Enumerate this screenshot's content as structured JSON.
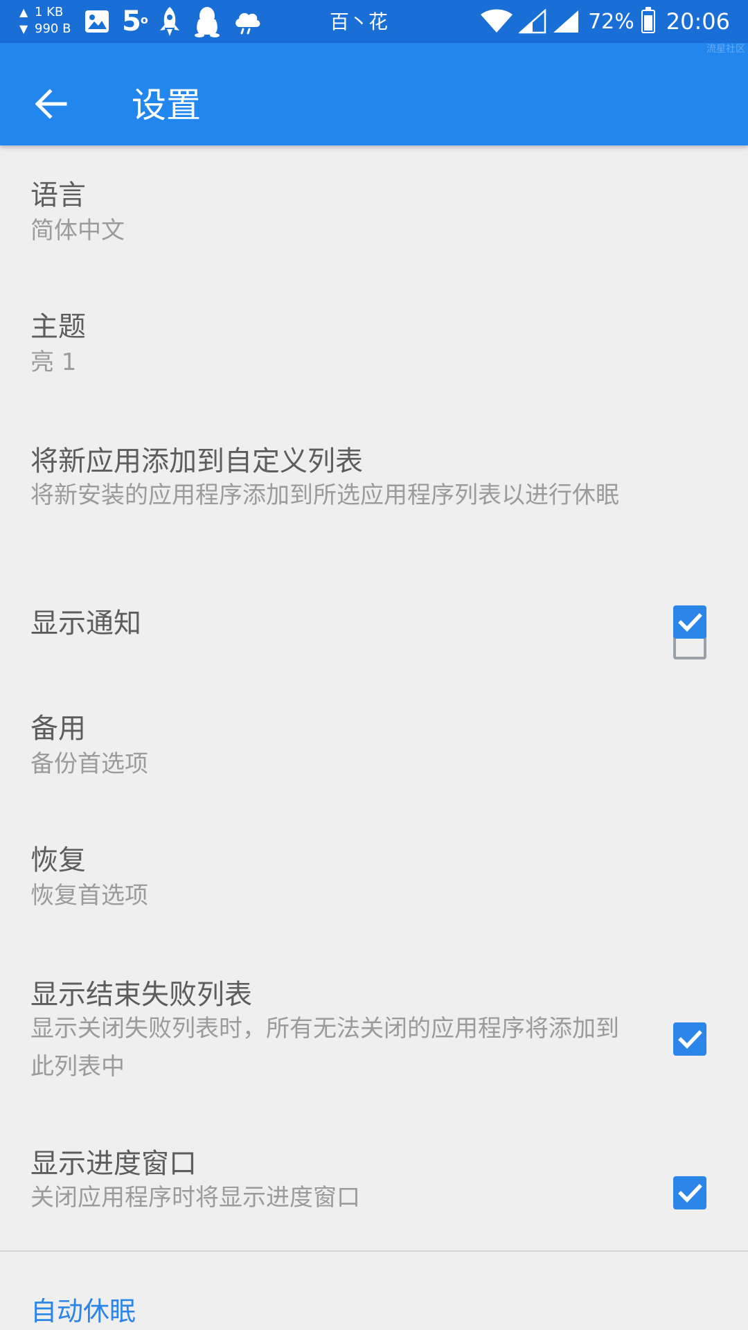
{
  "status_bar": {
    "upload_speed": "1 KB",
    "download_speed": "990 B",
    "temperature": "5",
    "carrier": "百丶花",
    "battery": "72%",
    "time": "20:06",
    "icons": [
      "image-icon",
      "weather-temp-icon",
      "rocket-icon",
      "qq-penguin-icon",
      "cloud-icon",
      "wifi-icon",
      "signal-icon",
      "signal-icon",
      "battery-icon"
    ]
  },
  "app_bar": {
    "title": "设置",
    "watermark": "流星社区",
    "color": "#2186ee"
  },
  "settings": [
    {
      "title": "语言",
      "summary": "简体中文"
    },
    {
      "title": "主题",
      "summary": "亮 1"
    },
    {
      "title": "将新应用添加到自定义列表",
      "summary": "将新安装的应用程序添加到所选应用程序列表以进行休眠",
      "checked": false
    },
    {
      "title": "显示通知",
      "checked": true
    },
    {
      "title": "备用",
      "summary": "备份首选项"
    },
    {
      "title": "恢复",
      "summary": "恢复首选项"
    },
    {
      "title": "显示结束失败列表",
      "summary": "显示关闭失败列表时，所有无法关闭的应用程序将添加到此列表中",
      "checked": true
    },
    {
      "title": "显示进度窗口",
      "summary": "关闭应用程序时将显示进度窗口",
      "checked": true
    }
  ],
  "section": {
    "title": "自动休眠",
    "accent_color": "#2c85e8"
  }
}
